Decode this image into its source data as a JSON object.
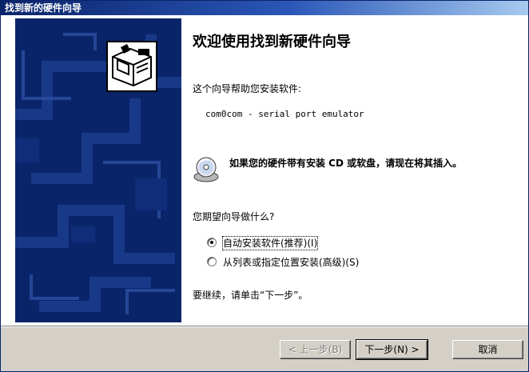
{
  "window": {
    "title": "找到新的硬件向导"
  },
  "wizard": {
    "heading": "欢迎使用找到新硬件向导",
    "intro": "这个向导帮助您安装软件:",
    "device_name": "com0com - serial port emulator",
    "cd_prompt": "如果您的硬件带有安装 CD 或软盘，请现在将其插入。",
    "question": "您期望向导做什么?",
    "options": [
      {
        "label": "自动安装软件(推荐)(I)",
        "selected": true
      },
      {
        "label": "从列表或指定位置安装(高级)(S)",
        "selected": false
      }
    ],
    "continue_hint": "要继续，请单击“下一步”。"
  },
  "buttons": {
    "back": "< 上一步(B)",
    "next": "下一步(N) >",
    "cancel": "取消"
  },
  "colors": {
    "titlebar_start": "#0a246a",
    "titlebar_end": "#a6caf0",
    "sidebar": "#0a246a",
    "face": "#d4d0c8"
  },
  "icons": {
    "hardware": "hardware-install-icon",
    "cd": "cd-disc-icon"
  }
}
